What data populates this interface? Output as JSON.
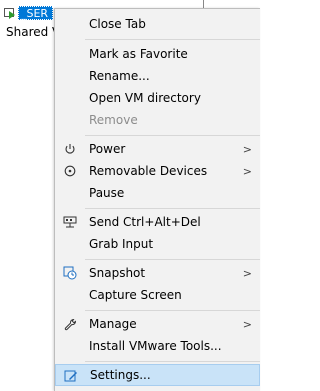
{
  "background": {
    "vm_tab_label": "_SER",
    "shared_label": "Shared V"
  },
  "menu": {
    "close_tab": "Close Tab",
    "mark_favorite": "Mark as Favorite",
    "rename": "Rename...",
    "open_vm_directory": "Open VM directory",
    "remove": "Remove",
    "power": "Power",
    "removable_devices": "Removable Devices",
    "pause": "Pause",
    "send_ctrl_alt_del": "Send Ctrl+Alt+Del",
    "grab_input": "Grab Input",
    "snapshot": "Snapshot",
    "capture_screen": "Capture Screen",
    "manage": "Manage",
    "install_tools": "Install VMware Tools...",
    "settings": "Settings...",
    "submenu_arrow": ">"
  },
  "colors": {
    "selection": "#c9e3f8",
    "tab_highlight": "#0078d7"
  }
}
